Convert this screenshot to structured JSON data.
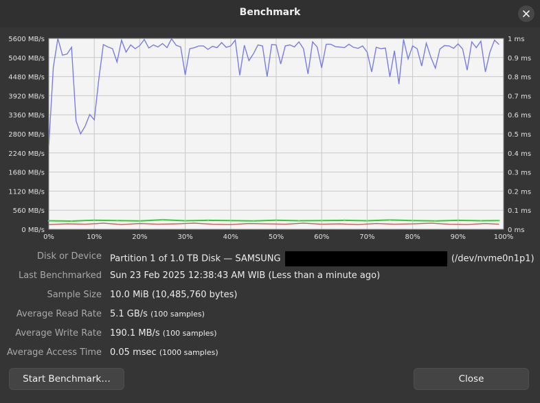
{
  "window": {
    "title": "Benchmark"
  },
  "chart_data": {
    "type": "line",
    "y_left_ticks": [
      "5600 MB/s",
      "5040 MB/s",
      "4480 MB/s",
      "3920 MB/s",
      "3360 MB/s",
      "2800 MB/s",
      "2240 MB/s",
      "1680 MB/s",
      "1120 MB/s",
      "560 MB/s",
      "0 MB/s"
    ],
    "y_right_ticks": [
      "1 ms",
      "0.9 ms",
      "0.8 ms",
      "0.7 ms",
      "0.6 ms",
      "0.5 ms",
      "0.4 ms",
      "0.3 ms",
      "0.2 ms",
      "0.1 ms",
      "0 ms"
    ],
    "x_ticks": [
      "0%",
      "10%",
      "20%",
      "30%",
      "40%",
      "50%",
      "60%",
      "70%",
      "80%",
      "90%",
      "100%"
    ],
    "ylim": [
      0,
      5600
    ],
    "y2lim": [
      0,
      1
    ],
    "xlim": [
      0,
      100
    ],
    "grid": true,
    "series": [
      {
        "color": "#7b7be8",
        "x": [
          0,
          1,
          2,
          3,
          4,
          5,
          6,
          7,
          8,
          9,
          10,
          11,
          12,
          13,
          14,
          15,
          16,
          17,
          18,
          19,
          20,
          21,
          22,
          23,
          24,
          25,
          26,
          27,
          28,
          29,
          30,
          31,
          32,
          33,
          34,
          35,
          36,
          37,
          38,
          39,
          40,
          41,
          42,
          43,
          44,
          45,
          46,
          47,
          48,
          49,
          50,
          51,
          52,
          53,
          54,
          55,
          56,
          57,
          58,
          59,
          60,
          61,
          62,
          63,
          64,
          65,
          66,
          67,
          68,
          69,
          70,
          71,
          72,
          73,
          74,
          75,
          76,
          77,
          78,
          79,
          80,
          81,
          82,
          83,
          84,
          85,
          86,
          87,
          88,
          89,
          90,
          91,
          92,
          93,
          94,
          95,
          96,
          97,
          98,
          99
        ],
        "values": [
          2450,
          4750,
          5600,
          5110,
          5140,
          5340,
          3180,
          2800,
          3030,
          3370,
          3210,
          4400,
          5420,
          5350,
          5300,
          4910,
          5550,
          5200,
          5410,
          5300,
          5390,
          5570,
          5320,
          5410,
          5350,
          5450,
          5330,
          5590,
          5400,
          5350,
          4530,
          5300,
          5330,
          5380,
          5380,
          5280,
          5370,
          5330,
          5480,
          5340,
          5380,
          5550,
          4520,
          5400,
          4950,
          5150,
          5410,
          5380,
          4480,
          5420,
          5410,
          4850,
          5380,
          5410,
          5350,
          5500,
          5300,
          4560,
          5500,
          5350,
          4740,
          5430,
          5430,
          5360,
          5350,
          5330,
          5430,
          5340,
          5310,
          5380,
          5200,
          4620,
          5340,
          5300,
          5320,
          4470,
          5240,
          4260,
          5570,
          5000,
          5380,
          5300,
          4790,
          5460,
          5050,
          4730,
          5290,
          5390,
          5380,
          5310,
          5440,
          5290,
          4670,
          5500,
          5330,
          5520,
          4620,
          5200,
          5550,
          5420
        ]
      },
      {
        "color": "#cc5a5a",
        "x": [
          0,
          4,
          8,
          12,
          16,
          20,
          24,
          28,
          32,
          36,
          40,
          44,
          48,
          52,
          56,
          60,
          64,
          68,
          72,
          76,
          80,
          84,
          88,
          92,
          96,
          99
        ],
        "values": [
          140,
          160,
          150,
          180,
          140,
          170,
          150,
          160,
          180,
          150,
          140,
          170,
          160,
          150,
          180,
          150,
          160,
          140,
          170,
          150,
          160,
          180,
          150,
          140,
          170,
          150
        ]
      },
      {
        "color": "#2fcf2f",
        "x": [
          0,
          5,
          10,
          15,
          20,
          25,
          30,
          35,
          40,
          45,
          50,
          55,
          60,
          65,
          70,
          75,
          80,
          85,
          90,
          95,
          99
        ],
        "values": [
          0.045,
          0.043,
          0.048,
          0.046,
          0.044,
          0.05,
          0.045,
          0.047,
          0.046,
          0.044,
          0.048,
          0.045,
          0.046,
          0.047,
          0.045,
          0.049,
          0.046,
          0.044,
          0.047,
          0.045,
          0.046
        ]
      }
    ]
  },
  "info": [
    {
      "label": "Disk or Device",
      "value_pre": "Partition 1 of 1.0 TB Disk — SAMSUNG",
      "value_post": "(/dev/nvme0n1p1)"
    },
    {
      "label": "Last Benchmarked",
      "value": "Sun 23 Feb 2025 12:38:43 AM WIB (Less than a minute ago)"
    },
    {
      "label": "Sample Size",
      "value": "10.0 MiB (10,485,760 bytes)"
    },
    {
      "label": "Average Read Rate",
      "value": "5.1 GB/s",
      "note": "(100 samples)"
    },
    {
      "label": "Average Write Rate",
      "value": "190.1 MB/s",
      "note": "(100 samples)"
    },
    {
      "label": "Average Access Time",
      "value": "0.05 msec",
      "note": "(1000 samples)"
    }
  ],
  "buttons": {
    "start": "Start Benchmark…",
    "close": "Close"
  }
}
